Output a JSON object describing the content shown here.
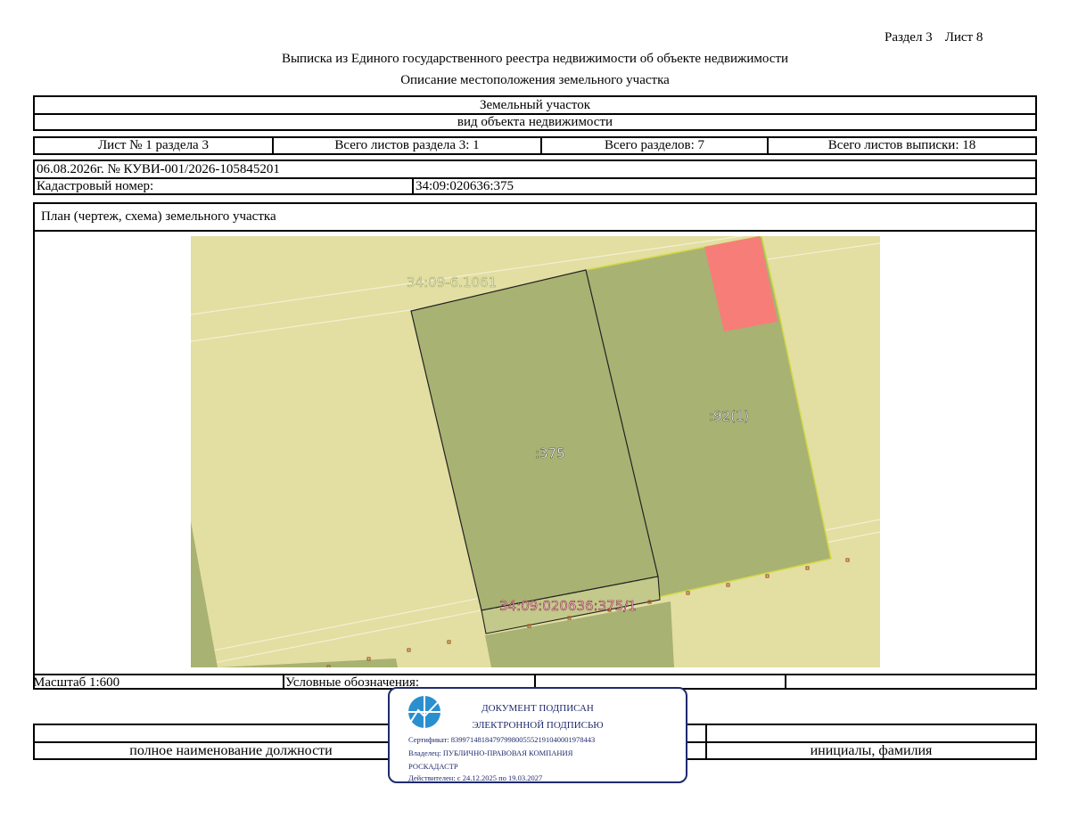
{
  "header": {
    "section": "Раздел 3",
    "sheet": "Лист 8",
    "title": "Выписка из Единого государственного реестра недвижимости об объекте недвижимости",
    "subtitle": "Описание местоположения земельного участка"
  },
  "object": {
    "type": "Земельный участок",
    "type_caption": "вид объекта недвижимости"
  },
  "sheet_info": {
    "sheet_no": "Лист № 1 раздела 3",
    "total_sheets_section": "Всего листов раздела 3: 1",
    "total_sections": "Всего разделов: 7",
    "total_sheets_extract": "Всего листов выписки: 18"
  },
  "record": {
    "date_number": "06.08.2026г. № КУВИ-001/2026-105845201",
    "cadastral_label": "Кадастровый номер:",
    "cadastral_value": "34:09:020636:375"
  },
  "plan": {
    "title": "План (чертеж, схема) земельного участка",
    "labels": {
      "quarter": "34:09-6.1061",
      "parcel": ":375",
      "neighbor": ":92(1)",
      "part": "34:09:020636:375/1"
    },
    "colors": {
      "background": "#e3dea2",
      "parcel_fill": "#a8b272",
      "highlight": "#f77d79",
      "boundary_yellow": "#d2d944",
      "points": "#a6602a"
    }
  },
  "scale": {
    "label": "Масштаб 1:600",
    "legend_label": "Условные обозначения:"
  },
  "signature": {
    "position_caption": "полное наименование должности",
    "name_caption": "инициалы, фамилия"
  },
  "stamp": {
    "line1": "ДОКУМЕНТ ПОДПИСАН",
    "line2": "ЭЛЕКТРОННОЙ ПОДПИСЬЮ",
    "certificate": "Сертификат: 8399714818479799800555219104000197844З",
    "owner": "Владелец: ПУБЛИЧНО-ПРАВОВАЯ КОМПАНИЯ",
    "owner2": "РОСКАДАСТР",
    "valid": "Действителен: с 24.12.2025 по 19.03.2027",
    "color": "#1f2a6e"
  }
}
